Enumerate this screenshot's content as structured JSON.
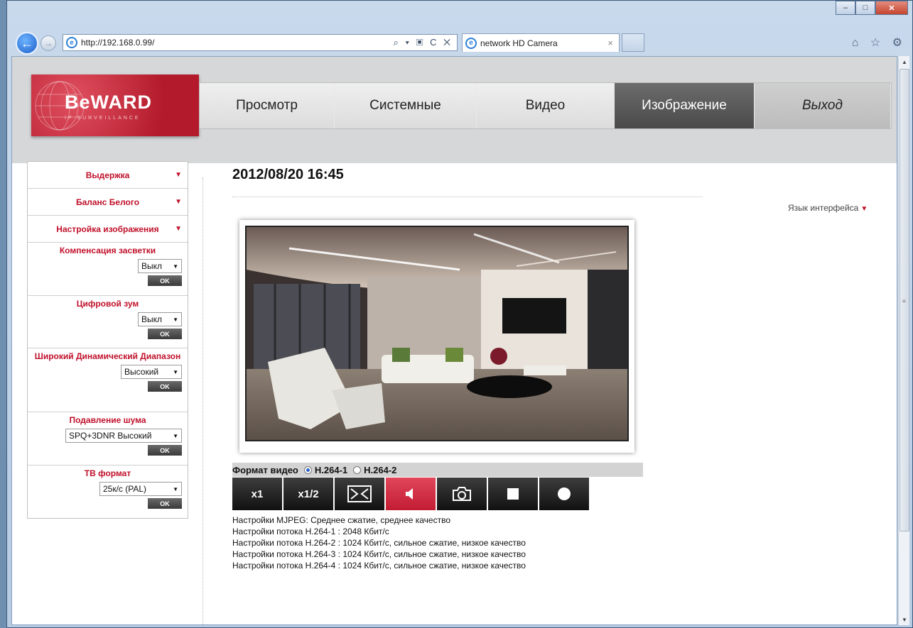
{
  "browser": {
    "address": "http://192.168.0.99/",
    "tab_title": "network HD Camera",
    "addr_tools": "⌕ ▾ ▣ C ✕",
    "browser_icons": "⌂ ☆ ⚙"
  },
  "logo": {
    "brand": "BeWARD",
    "tagline": "IP SURVEILLANCE"
  },
  "menu": {
    "items": [
      {
        "label": "Просмотр"
      },
      {
        "label": "Системные"
      },
      {
        "label": "Видео"
      },
      {
        "label": "Изображение"
      },
      {
        "label": "Выход"
      }
    ],
    "active_index": 3
  },
  "sidebar": {
    "sections": [
      "Выдержка",
      "Баланс Белого",
      "Настройка изображения"
    ],
    "settings": [
      {
        "title": "Компенсация засветки",
        "value": "Выкл",
        "ok": "OK"
      },
      {
        "title": "Цифровой зум",
        "value": "Выкл",
        "ok": "OK"
      },
      {
        "title": "Широкий Динамический Диапазон",
        "value": "Высокий",
        "ok": "OK"
      },
      {
        "title": "Подавление шума",
        "value": "SPQ+3DNR Высокий",
        "ok": "OK"
      },
      {
        "title": "ТВ формат",
        "value": "25к/с (PAL)",
        "ok": "OK"
      }
    ]
  },
  "main": {
    "datetime": "2012/08/20 16:45",
    "language_label": "Язык интерфейса",
    "format_label": "Формат видео",
    "format_options": [
      "H.264-1",
      "H.264-2"
    ],
    "format_selected": "H.264-1",
    "controls": [
      "x1",
      "x1/2"
    ],
    "info_lines": [
      "Настройки MJPEG: Среднее сжатие, среднее качество",
      "Настройки потока H.264-1 : 2048 Кбит/с",
      "Настройки потока H.264-2 : 1024 Кбит/с, сильное сжатие, низкое качество",
      "Настройки потока H.264-3 : 1024 Кбит/с, сильное сжатие, низкое качество",
      "Настройки потока H.264-4 : 1024 Кбит/с, сильное сжатие, низкое качество"
    ]
  },
  "colors": {
    "brand_red": "#c0102a",
    "menu_active": "#555555"
  }
}
